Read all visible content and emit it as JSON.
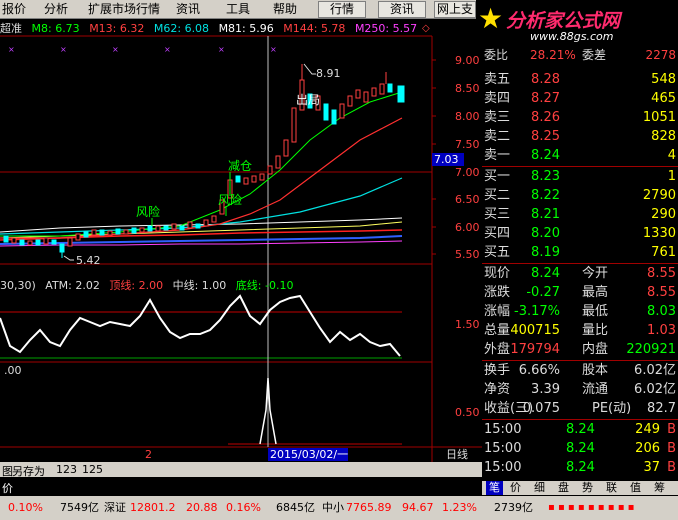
{
  "menu": {
    "items": [
      "报价",
      "分析",
      "扩展市场行情",
      "资讯",
      "工具",
      "帮助"
    ],
    "buttons": [
      "行情",
      "资讯",
      "网上支"
    ]
  },
  "logo": {
    "title": "分析家公式网",
    "url": "www.88gs.com"
  },
  "ma_bar": {
    "prefix": "超准",
    "items": [
      {
        "label": "M8: 6.73",
        "color": "#00ff00"
      },
      {
        "label": "M13: 6.32",
        "color": "#ff4040"
      },
      {
        "label": "M62: 6.08",
        "color": "#00e0e0"
      },
      {
        "label": "M81: 5.96",
        "color": "#ffffff"
      },
      {
        "label": "M144: 5.78",
        "color": "#ff4040"
      },
      {
        "label": "M250: 5.57",
        "color": "#ff40ff"
      }
    ]
  },
  "chart": {
    "price_ticks": [
      "9.00",
      "8.50",
      "8.00",
      "7.50",
      "7.00",
      "6.50",
      "6.00",
      "5.50"
    ],
    "current_price": "7.03",
    "high_label": "8.91",
    "low_label": "5.42",
    "annotations": [
      "风险",
      "风险",
      "减仓",
      "出局"
    ],
    "indicator_bar": {
      "params": "30,30)",
      "atm": "ATM: 2.02",
      "top": "顶线: 2.00",
      "mid": "中线: 1.00",
      "bottom": "底线: -0.10"
    },
    "indicator_ticks": [
      "1.50"
    ],
    "lower_label": ".00",
    "lower_ticks": [
      "0.50"
    ],
    "date_label": "2015/03/02/一",
    "mark_2": "2",
    "period": "日线"
  },
  "status_tabs": {
    "save": "另存为",
    "a": "123",
    "b": "125"
  },
  "order_book": {
    "top": {
      "left": "委比",
      "left_val": "28.21%",
      "right": "委差",
      "right_val": "2278"
    },
    "asks": [
      {
        "label": "卖五",
        "price": "8.28",
        "vol": "548"
      },
      {
        "label": "卖四",
        "price": "8.27",
        "vol": "465"
      },
      {
        "label": "卖三",
        "price": "8.26",
        "vol": "1051"
      },
      {
        "label": "卖二",
        "price": "8.25",
        "vol": "828"
      },
      {
        "label": "卖一",
        "price": "8.24",
        "vol": "4"
      }
    ],
    "bids": [
      {
        "label": "买一",
        "price": "8.23",
        "vol": "1"
      },
      {
        "label": "买二",
        "price": "8.22",
        "vol": "2790"
      },
      {
        "label": "买三",
        "price": "8.21",
        "vol": "290"
      },
      {
        "label": "买四",
        "price": "8.20",
        "vol": "1330"
      },
      {
        "label": "买五",
        "price": "8.19",
        "vol": "761"
      }
    ],
    "stats": [
      {
        "l1": "现价",
        "v1": "8.24",
        "c1": "#00ff00",
        "l2": "今开",
        "v2": "8.55",
        "c2": "#ff4040"
      },
      {
        "l1": "涨跌",
        "v1": "-0.27",
        "c1": "#00ff00",
        "l2": "最高",
        "v2": "8.55",
        "c2": "#ff4040"
      },
      {
        "l1": "涨幅",
        "v1": "-3.17%",
        "c1": "#00ff00",
        "l2": "最低",
        "v2": "8.03",
        "c2": "#00ff00"
      },
      {
        "l1": "总量",
        "v1": "400715",
        "c1": "#ffff00",
        "l2": "量比",
        "v2": "1.03",
        "c2": "#ff4040"
      },
      {
        "l1": "外盘",
        "v1": "179794",
        "c1": "#ff4040",
        "l2": "内盘",
        "v2": "220921",
        "c2": "#00ff00"
      }
    ],
    "finance": [
      {
        "l1": "换手",
        "v1": "6.66%",
        "l2": "股本",
        "v2": "6.02亿"
      },
      {
        "l1": "净资",
        "v1": "3.39",
        "l2": "流通",
        "v2": "6.02亿"
      },
      {
        "l1": "收益(三)",
        "v1": "0.075",
        "l2": "PE(动)",
        "v2": "82.7"
      }
    ],
    "ticks": [
      {
        "time": "15:00",
        "price": "8.24",
        "vol": "249",
        "dir": "B"
      },
      {
        "time": "15:00",
        "price": "8.24",
        "vol": "206",
        "dir": "B"
      },
      {
        "time": "15:00",
        "price": "8.24",
        "vol": "37",
        "dir": "B"
      }
    ],
    "tabs": [
      "笔",
      "价",
      "细",
      "盘",
      "势",
      "联",
      "值",
      "筹"
    ]
  },
  "bottom_bar": {
    "left": "价",
    "items": [
      {
        "text": "0.10%",
        "color": "#ff0000"
      },
      {
        "text": "7549亿",
        "color": "#000000"
      },
      {
        "text": "深证",
        "color": "#000000"
      },
      {
        "text": "12801.2",
        "color": "#ff0000"
      },
      {
        "text": "20.88",
        "color": "#ff0000"
      },
      {
        "text": "0.16%",
        "color": "#ff0000"
      },
      {
        "text": "6845亿",
        "color": "#000000"
      },
      {
        "text": "中小",
        "color": "#000000"
      },
      {
        "text": "7765.89",
        "color": "#ff0000"
      },
      {
        "text": "94.67",
        "color": "#ff0000"
      },
      {
        "text": "1.23%",
        "color": "#ff0000"
      },
      {
        "text": "2739亿",
        "color": "#000000"
      }
    ]
  }
}
